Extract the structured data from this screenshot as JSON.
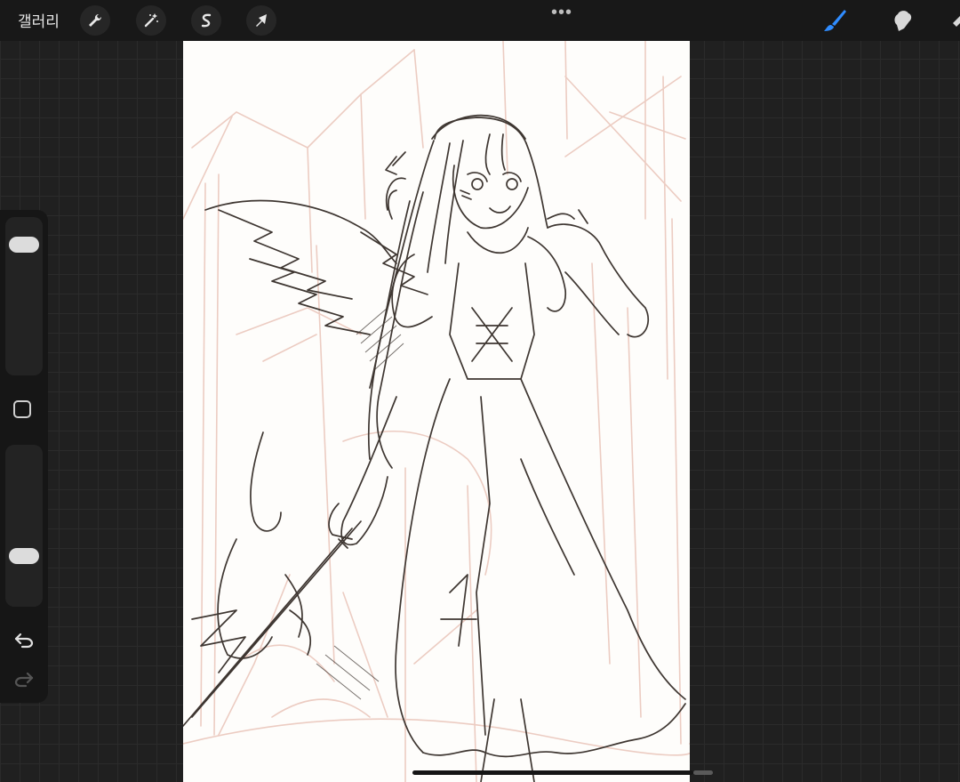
{
  "topbar": {
    "gallery_label": "갤러리",
    "more_label": "•••",
    "tools": [
      {
        "name": "actions",
        "icon": "wrench-icon"
      },
      {
        "name": "adjustments",
        "icon": "magic-wand-icon"
      },
      {
        "name": "selection",
        "icon": "selection-s-icon"
      },
      {
        "name": "transform",
        "icon": "arrow-cursor-icon"
      }
    ],
    "right_tools": [
      {
        "name": "brush",
        "icon": "brush-icon",
        "active": true,
        "color": "#2f8cff"
      },
      {
        "name": "smudge",
        "icon": "smudge-icon",
        "active": false
      }
    ]
  },
  "sidebar": {
    "brush_size_level": 0.9,
    "opacity_level": 0.1,
    "modify_icon": "square-icon",
    "undo_icon": "undo-icon",
    "redo_icon": "redo-icon"
  },
  "canvas": {
    "background": "#fefdfb",
    "line_color": "#3e3631",
    "sketch_color": "#e8c9bf"
  }
}
